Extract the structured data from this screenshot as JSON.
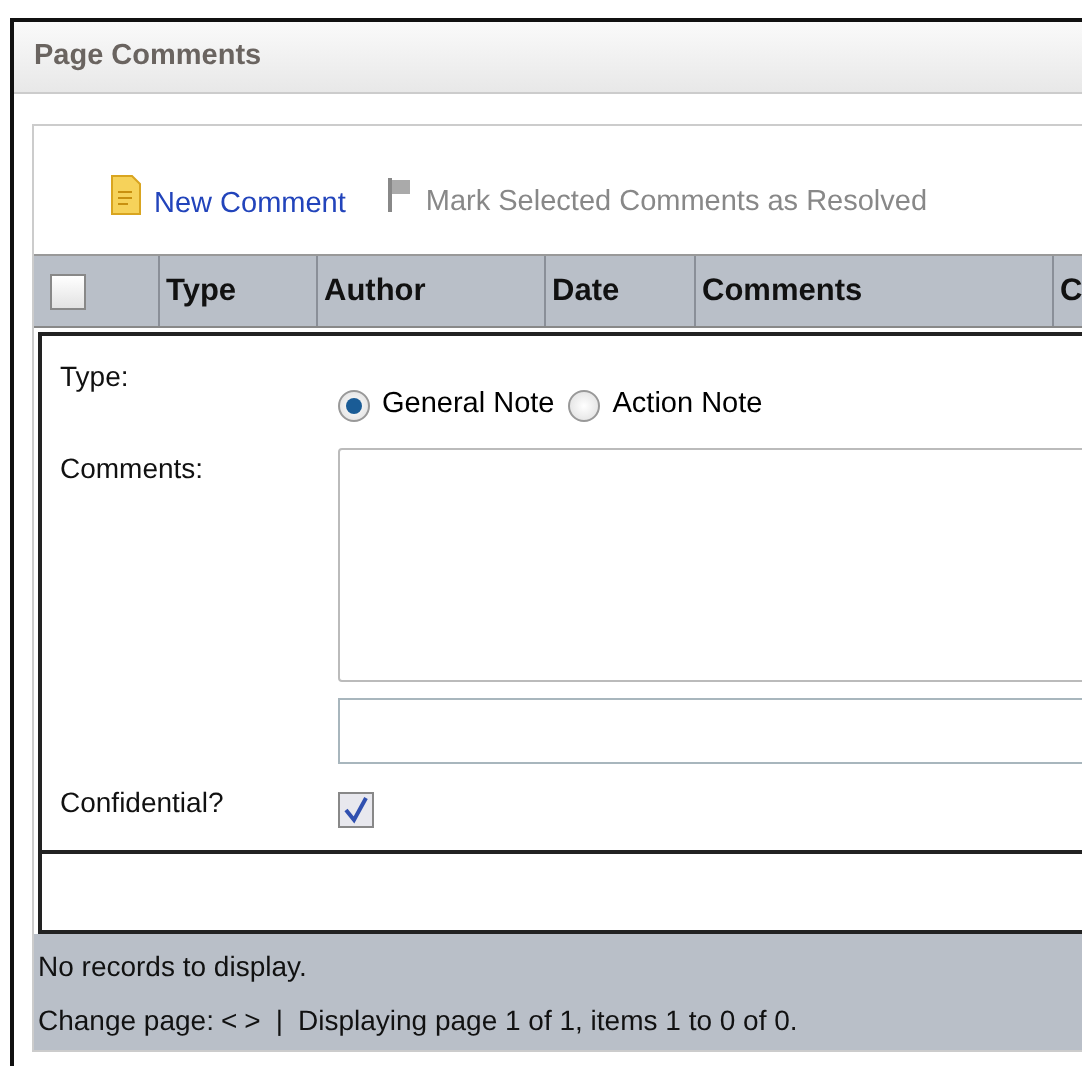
{
  "window": {
    "title": "Page Comments"
  },
  "toolbar": [
    {
      "kind": "new",
      "label": "New Comment",
      "disabled": false
    },
    {
      "kind": "flag",
      "label": "Mark Selected Comments as Resolved",
      "disabled": true
    }
  ],
  "table": {
    "select_all": {
      "checked": false
    },
    "columns": [
      "Type",
      "Author",
      "Date",
      "Comments",
      "C"
    ]
  },
  "form": {
    "type": {
      "label": "Type:",
      "options": [
        {
          "label": "General Note",
          "selected": true
        },
        {
          "label": "Action Note",
          "selected": false
        }
      ]
    },
    "comments": {
      "label": "Comments:"
    },
    "confidential": {
      "label": "Confidential?",
      "checked": true
    }
  },
  "footer": {
    "message": "No records to display.",
    "pager_label": "Change page:",
    "prev": "<",
    "next": ">",
    "separator": "|",
    "status": "Displaying page 1 of 1, items 1 to 0 of 0."
  }
}
